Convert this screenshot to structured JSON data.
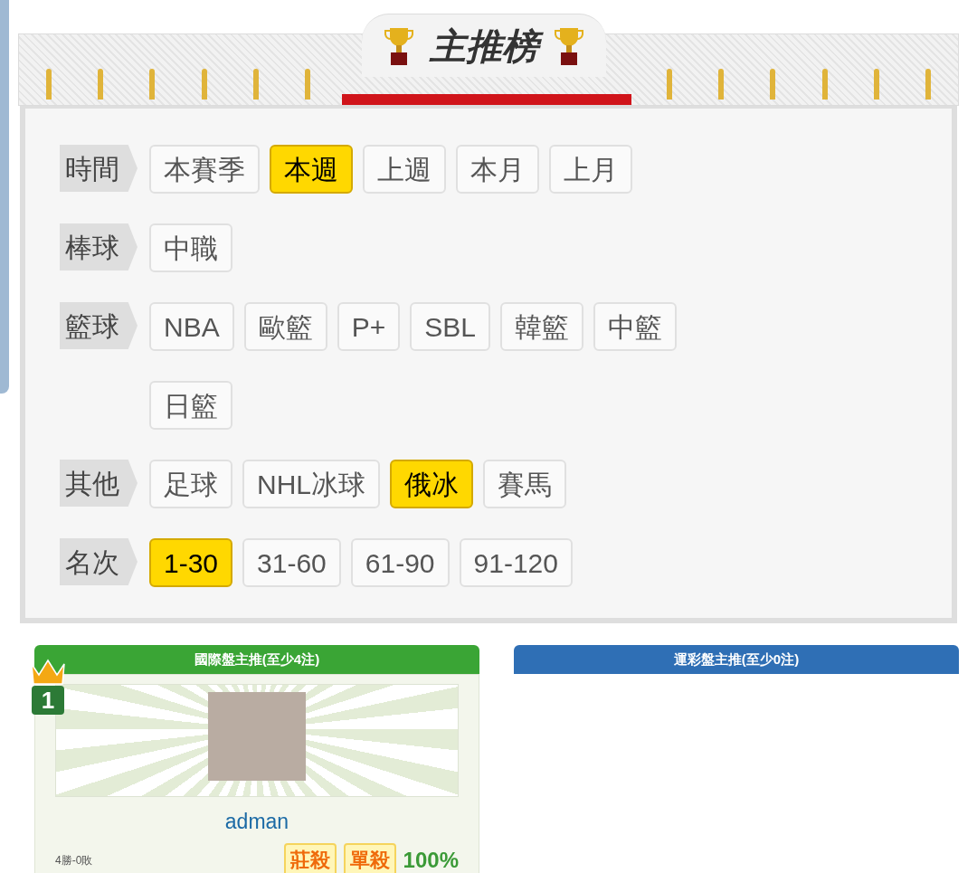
{
  "banner": {
    "title": "主推榜"
  },
  "filters": [
    {
      "label": "時間",
      "options": [
        {
          "text": "本賽季",
          "selected": false
        },
        {
          "text": "本週",
          "selected": true
        },
        {
          "text": "上週",
          "selected": false
        },
        {
          "text": "本月",
          "selected": false
        },
        {
          "text": "上月",
          "selected": false
        }
      ]
    },
    {
      "label": "棒球",
      "options": [
        {
          "text": "中職",
          "selected": false
        }
      ]
    },
    {
      "label": "籃球",
      "options": [
        {
          "text": "NBA",
          "selected": false
        },
        {
          "text": "歐籃",
          "selected": false
        },
        {
          "text": "P+",
          "selected": false
        },
        {
          "text": "SBL",
          "selected": false
        },
        {
          "text": "韓籃",
          "selected": false
        },
        {
          "text": "中籃",
          "selected": false
        },
        {
          "text": "日籃",
          "selected": false
        }
      ]
    },
    {
      "label": "其他",
      "options": [
        {
          "text": "足球",
          "selected": false
        },
        {
          "text": "NHL冰球",
          "selected": false
        },
        {
          "text": "俄冰",
          "selected": true
        },
        {
          "text": "賽馬",
          "selected": false
        }
      ]
    },
    {
      "label": "名次",
      "options": [
        {
          "text": "1-30",
          "selected": true
        },
        {
          "text": "31-60",
          "selected": false
        },
        {
          "text": "61-90",
          "selected": false
        },
        {
          "text": "91-120",
          "selected": false
        }
      ]
    }
  ],
  "boards": [
    {
      "kind": "green",
      "title": "國際盤主推(至少4注)",
      "entries": [
        {
          "rank": "1",
          "name": "adman",
          "record": "4勝-0敗",
          "tags": [
            "莊殺",
            "單殺"
          ],
          "rate": "100%"
        }
      ]
    },
    {
      "kind": "blue",
      "title": "運彩盤主推(至少0注)"
    }
  ]
}
